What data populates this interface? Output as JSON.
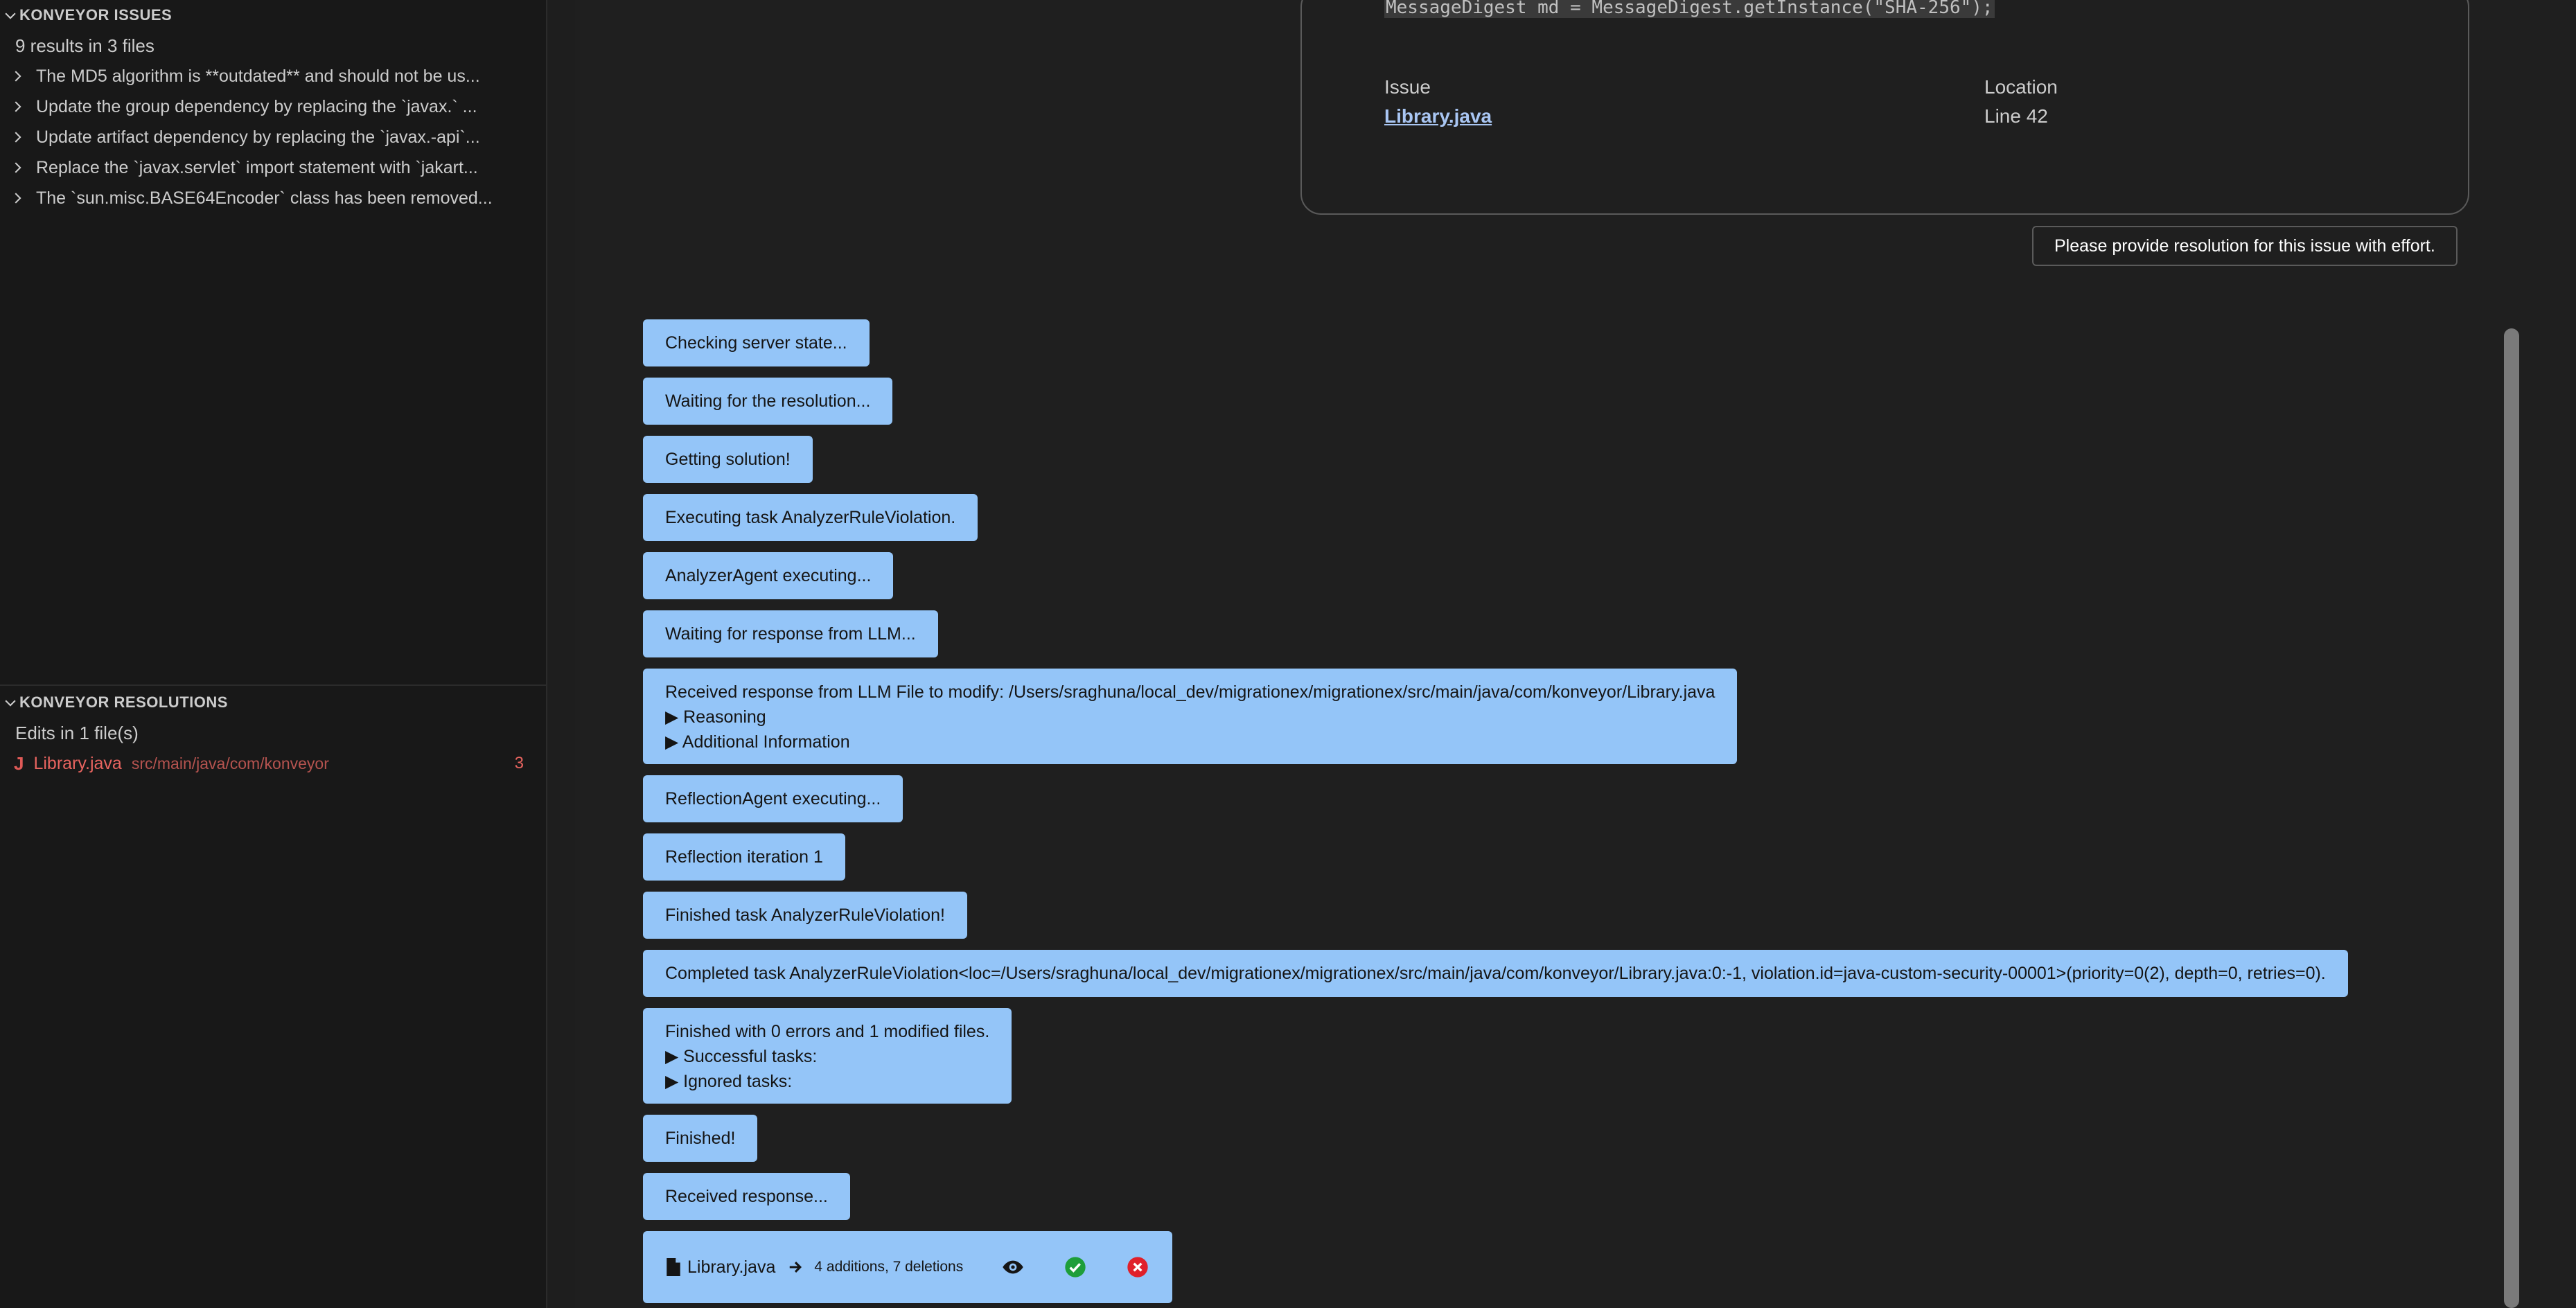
{
  "issues_panel": {
    "title": "KONVEYOR ISSUES",
    "summary": "9 results in 3 files",
    "items": [
      {
        "label": "The MD5 algorithm is **outdated** and should not be us..."
      },
      {
        "label": "Update the group dependency by replacing the `javax.` ..."
      },
      {
        "label": "Update artifact dependency by replacing the `javax.-api`..."
      },
      {
        "label": "Replace the `javax.servlet` import statement with `jakart..."
      },
      {
        "label": "The `sun.misc.BASE64Encoder` class has been removed..."
      }
    ]
  },
  "resolutions_panel": {
    "title": "KONVEYOR RESOLUTIONS",
    "summary": "Edits in 1 file(s)",
    "file": {
      "icon": "J",
      "name": "Library.java",
      "path": "src/main/java/com/konveyor",
      "count": "3"
    }
  },
  "issue_card": {
    "code_snippet": "MessageDigest md = MessageDigest.getInstance(\"SHA-256\");",
    "issue_label": "Issue",
    "issue_value": "Library.java",
    "location_label": "Location",
    "location_value": "Line 42"
  },
  "resolve_button": "Please provide resolution for this issue with effort.",
  "messages": [
    {
      "text": "Checking server state..."
    },
    {
      "text": "Waiting for the resolution..."
    },
    {
      "text": "Getting solution!"
    },
    {
      "text": "Executing task AnalyzerRuleViolation."
    },
    {
      "text": "AnalyzerAgent executing..."
    },
    {
      "text": "Waiting for response from LLM..."
    },
    {
      "text": "Received response from LLM File to modify: /Users/sraghuna/local_dev/migrationex/migrationex/src/main/java/com/konveyor/Library.java",
      "details": [
        "Reasoning",
        "Additional Information"
      ]
    },
    {
      "text": "ReflectionAgent executing..."
    },
    {
      "text": "Reflection iteration 1"
    },
    {
      "text": "Finished task AnalyzerRuleViolation!"
    },
    {
      "text": "Completed task AnalyzerRuleViolation<loc=/Users/sraghuna/local_dev/migrationex/migrationex/src/main/java/com/konveyor/Library.java:0:-1, violation.id=java-custom-security-00001>(priority=0(2), depth=0, retries=0)."
    },
    {
      "text": "Finished with 0 errors and 1 modified files.",
      "details": [
        "Successful tasks:",
        "Ignored tasks:"
      ]
    },
    {
      "text": "Finished!"
    },
    {
      "text": "Received response..."
    }
  ],
  "diff": {
    "file": "Library.java",
    "changes": "4 additions, 7 deletions"
  },
  "colors": {
    "message_bg": "#94c5f8",
    "error_text": "#e8645f",
    "accept": "#1e9e3a",
    "reject": "#e0202a"
  }
}
